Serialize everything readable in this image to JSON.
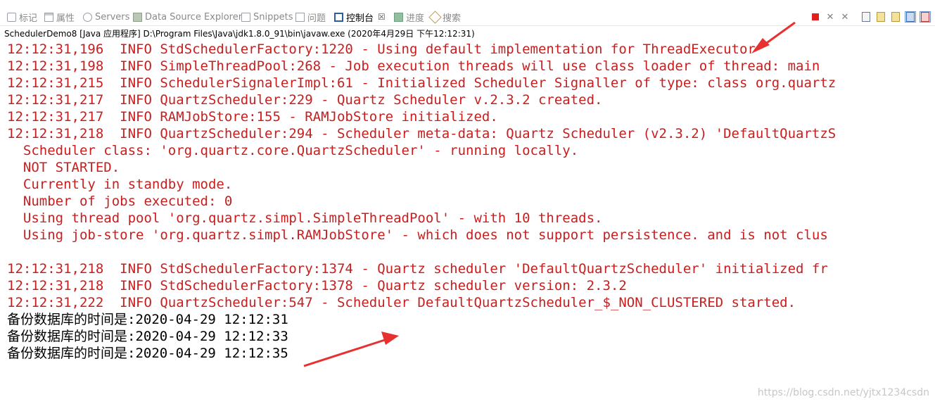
{
  "tabs": [
    {
      "label": "标记",
      "icon": "markers-icon",
      "active": false
    },
    {
      "label": "属性",
      "icon": "properties-icon",
      "active": false
    },
    {
      "label": "Servers",
      "icon": "servers-icon",
      "active": false
    },
    {
      "label": "Data Source Explorer",
      "icon": "data-source-icon",
      "active": false
    },
    {
      "label": "Snippets",
      "icon": "snippets-icon",
      "active": false
    },
    {
      "label": "问题",
      "icon": "problems-icon",
      "active": false
    },
    {
      "label": "控制台",
      "icon": "console-icon",
      "active": true,
      "close": "☒"
    },
    {
      "label": "进度",
      "icon": "progress-icon",
      "active": false
    },
    {
      "label": "搜索",
      "icon": "search-icon",
      "active": false
    }
  ],
  "toolbar": {
    "buttons": [
      "terminate-icon",
      "remove-launch-icon",
      "remove-all-terminated-icon",
      "scroll-lock-icon",
      "show-stdout-icon",
      "show-stderr-icon",
      "pin-console-icon",
      "display-selected-console-icon"
    ],
    "terminate_color": "#e02020"
  },
  "launch_label": "SchedulerDemo8 [Java 应用程序] D:\\Program Files\\Java\\jdk1.8.0_91\\bin\\javaw.exe (2020年4月29日 下午12:12:31)",
  "colors": {
    "stderr": "#c81e1e",
    "stdout": "#000000",
    "arrow": "#e83030"
  },
  "console": {
    "lines": [
      {
        "text": "12:12:31,196  INFO StdSchedulerFactory:1220 - Using default implementation for ThreadExecutor",
        "stream": "err"
      },
      {
        "text": "12:12:31,198  INFO SimpleThreadPool:268 - Job execution threads will use class loader of thread: main",
        "stream": "err"
      },
      {
        "text": "12:12:31,215  INFO SchedulerSignalerImpl:61 - Initialized Scheduler Signaller of type: class org.quartz",
        "stream": "err"
      },
      {
        "text": "12:12:31,217  INFO QuartzScheduler:229 - Quartz Scheduler v.2.3.2 created.",
        "stream": "err"
      },
      {
        "text": "12:12:31,217  INFO RAMJobStore:155 - RAMJobStore initialized.",
        "stream": "err"
      },
      {
        "text": "12:12:31,218  INFO QuartzScheduler:294 - Scheduler meta-data: Quartz Scheduler (v2.3.2) 'DefaultQuartzS",
        "stream": "err"
      },
      {
        "text": "  Scheduler class: 'org.quartz.core.QuartzScheduler' - running locally.",
        "stream": "err"
      },
      {
        "text": "  NOT STARTED.",
        "stream": "err"
      },
      {
        "text": "  Currently in standby mode.",
        "stream": "err"
      },
      {
        "text": "  Number of jobs executed: 0",
        "stream": "err"
      },
      {
        "text": "  Using thread pool 'org.quartz.simpl.SimpleThreadPool' - with 10 threads.",
        "stream": "err"
      },
      {
        "text": "  Using job-store 'org.quartz.simpl.RAMJobStore' - which does not support persistence. and is not clus",
        "stream": "err"
      },
      {
        "text": " ",
        "stream": "err"
      },
      {
        "text": "12:12:31,218  INFO StdSchedulerFactory:1374 - Quartz scheduler 'DefaultQuartzScheduler' initialized fr",
        "stream": "err"
      },
      {
        "text": "12:12:31,218  INFO StdSchedulerFactory:1378 - Quartz scheduler version: 2.3.2",
        "stream": "err"
      },
      {
        "text": "12:12:31,222  INFO QuartzScheduler:547 - Scheduler DefaultQuartzScheduler_$_NON_CLUSTERED started.",
        "stream": "err"
      },
      {
        "text": "备份数据库的时间是:2020-04-29 12:12:31",
        "stream": "out"
      },
      {
        "text": "备份数据库的时间是:2020-04-29 12:12:33",
        "stream": "out"
      },
      {
        "text": "备份数据库的时间是:2020-04-29 12:12:35",
        "stream": "out"
      }
    ]
  },
  "watermark": "https://blog.csdn.net/yjtx1234csdn"
}
